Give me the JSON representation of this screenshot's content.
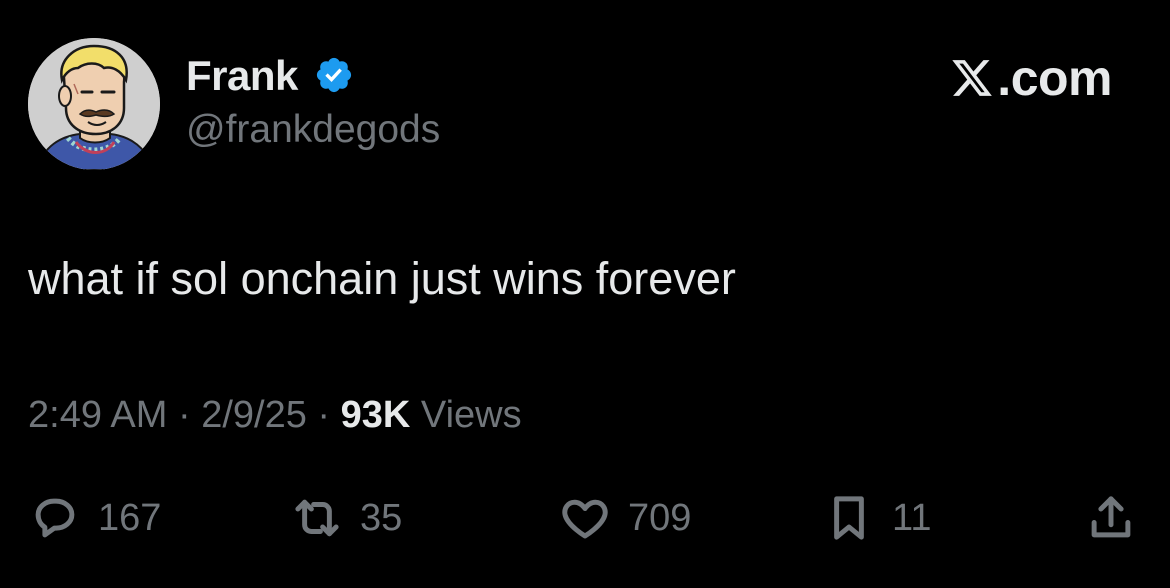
{
  "author": {
    "display_name": "Frank",
    "handle": "@frankdegods",
    "verified": true,
    "avatar_icon": "cartoon-avatar"
  },
  "brand": {
    "label": ".com",
    "icon": "x-logo-icon"
  },
  "tweet": {
    "text": "what if sol onchain just wins forever"
  },
  "meta": {
    "time": "2:49 AM",
    "separator": "·",
    "date": "2/9/25",
    "views_count": "93K",
    "views_label": "Views"
  },
  "actions": {
    "replies": "167",
    "reposts": "35",
    "likes": "709",
    "bookmarks": "11"
  },
  "colors": {
    "background": "#000000",
    "primary_text": "#e7e9ea",
    "secondary_text": "#71767b",
    "verified_blue": "#1d9bf0"
  }
}
